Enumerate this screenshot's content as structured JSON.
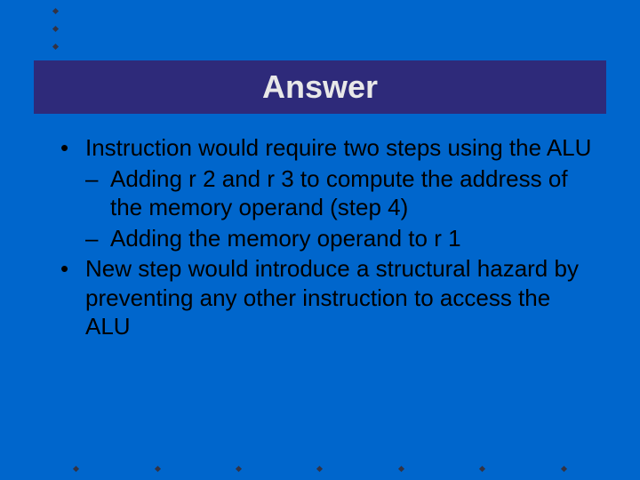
{
  "title": "Answer",
  "bullets": [
    {
      "level": 1,
      "text": "Instruction would require two steps using the ALU"
    },
    {
      "level": 2,
      "text": "Adding r 2 and r 3 to compute the address of the memory operand (step 4)"
    },
    {
      "level": 2,
      "text": "Adding the memory operand to r 1"
    },
    {
      "level": 1,
      "text": "New step would introduce a structural hazard by preventing any other instruction to access the ALU"
    }
  ]
}
